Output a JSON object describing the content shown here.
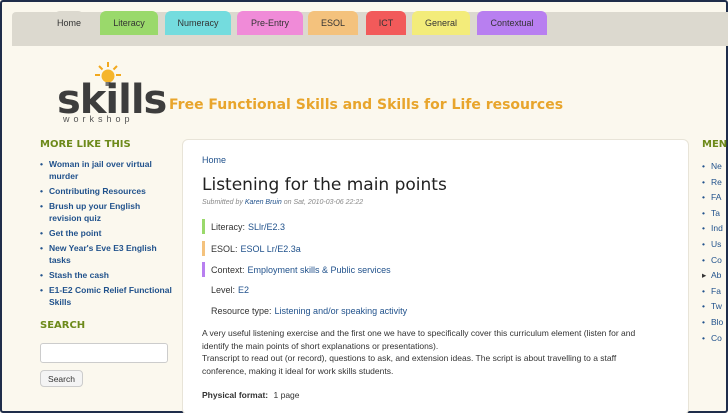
{
  "nav": {
    "tabs": [
      {
        "label": "Home",
        "color": "#dcd9cf"
      },
      {
        "label": "Literacy",
        "color": "#9ad96b"
      },
      {
        "label": "Numeracy",
        "color": "#74dcde"
      },
      {
        "label": "Pre-Entry",
        "color": "#f08bd8"
      },
      {
        "label": "ESOL",
        "color": "#f4c27d"
      },
      {
        "label": "ICT",
        "color": "#f25a5a"
      },
      {
        "label": "General",
        "color": "#f3ec7a"
      },
      {
        "label": "Contextual",
        "color": "#b87ff0"
      }
    ]
  },
  "logo": {
    "text": "skills",
    "sub": "workshop"
  },
  "tagline": "Free Functional Skills and Skills for Life resources",
  "sidebar": {
    "heading": "MORE LIKE THIS",
    "items": [
      "Woman in jail over virtual murder",
      "Contributing Resources",
      "Brush up your English revision quiz",
      "Get the point",
      "New Year's Eve E3 English tasks",
      "Stash the cash",
      "E1-E2 Comic Relief Functional Skills"
    ],
    "search_heading": "SEARCH",
    "search_placeholder": "",
    "search_button": "Search"
  },
  "main": {
    "breadcrumb": "Home",
    "title": "Listening for the main points",
    "submitted_prefix": "Submitted by",
    "author": "Karen Bruin",
    "submitted_suffix": "on Sat, 2010-03-06 22:22",
    "fields": [
      {
        "label": "Literacy:",
        "value": "SLlr/E2.3",
        "color": "#9ad96b"
      },
      {
        "label": "ESOL:",
        "value": "ESOL Lr/E2.3a",
        "color": "#f4c27d"
      },
      {
        "label": "Context:",
        "value": "Employment skills & Public services",
        "color": "#b87ff0"
      },
      {
        "label": "Level:",
        "value": "E2",
        "color": ""
      },
      {
        "label": "Resource type:",
        "value": "Listening and/or speaking activity",
        "color": ""
      }
    ],
    "description": [
      "A very useful listening exercise and the first one we have to specifically cover this curriculum element (listen for and",
      "identify the main points of short explanations or presentations).",
      "Transcript to read out (or record), questions to ask, and extension ideas. The script is about travelling to a staff",
      "conference, making it ideal for work skills students."
    ],
    "physical_label": "Physical format:",
    "physical_value": "1 page"
  },
  "menu": {
    "heading": "MENU",
    "items": [
      "Ne",
      "Re",
      "FA",
      "Ta",
      "Ind",
      "Us",
      "Co",
      "Ab",
      "Fa",
      "Tw",
      "Blo",
      "Co"
    ]
  }
}
